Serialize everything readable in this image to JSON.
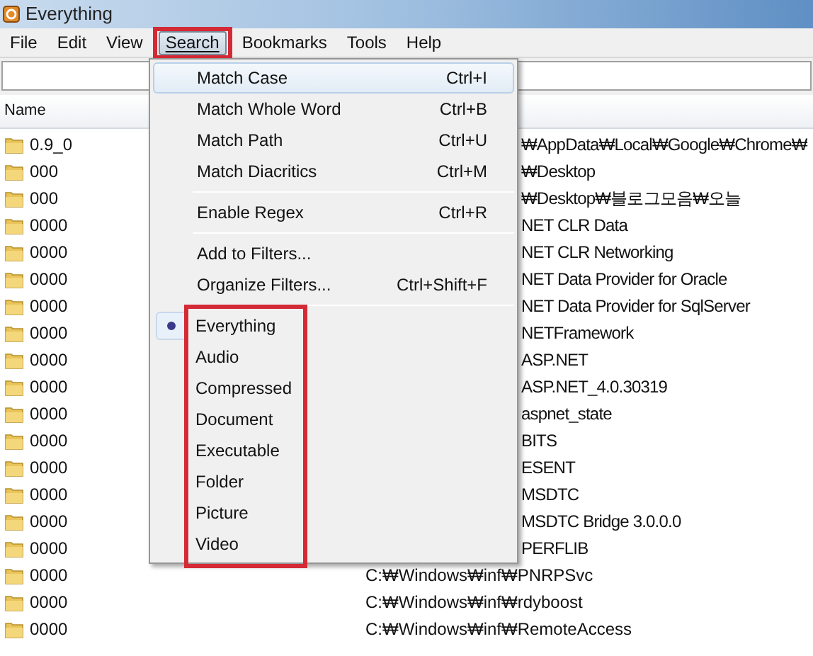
{
  "window": {
    "title": "Everything"
  },
  "menu_bar": [
    {
      "label": "File",
      "selected": false,
      "highlighted": false
    },
    {
      "label": "Edit",
      "selected": false,
      "highlighted": false
    },
    {
      "label": "View",
      "selected": false,
      "highlighted": false
    },
    {
      "label": "Search",
      "selected": true,
      "highlighted": true
    },
    {
      "label": "Bookmarks",
      "selected": false,
      "highlighted": false
    },
    {
      "label": "Tools",
      "selected": false,
      "highlighted": false
    },
    {
      "label": "Help",
      "selected": false,
      "highlighted": false
    }
  ],
  "table": {
    "columns": [
      "Name"
    ],
    "rows": [
      {
        "name": "0.9_0",
        "path": "₩AppData₩Local₩Google₩Chrome₩",
        "kind": "cut"
      },
      {
        "name": "000",
        "path": "₩Desktop",
        "kind": "cut"
      },
      {
        "name": "000",
        "path": "₩Desktop₩블로그모음₩오늘",
        "kind": "cut"
      },
      {
        "name": "0000",
        "path": "NET CLR Data",
        "kind": "cut"
      },
      {
        "name": "0000",
        "path": "NET CLR Networking",
        "kind": "cut"
      },
      {
        "name": "0000",
        "path": "NET Data Provider for Oracle",
        "kind": "cut"
      },
      {
        "name": "0000",
        "path": "NET Data Provider for SqlServer",
        "kind": "cut"
      },
      {
        "name": "0000",
        "path": "NETFramework",
        "kind": "cut"
      },
      {
        "name": "0000",
        "path": "ASP.NET",
        "kind": "cut"
      },
      {
        "name": "0000",
        "path": "ASP.NET_4.0.30319",
        "kind": "cut"
      },
      {
        "name": "0000",
        "path": "aspnet_state",
        "kind": "cut"
      },
      {
        "name": "0000",
        "path": "BITS",
        "kind": "cut"
      },
      {
        "name": "0000",
        "path": "ESENT",
        "kind": "cut"
      },
      {
        "name": "0000",
        "path": "MSDTC",
        "kind": "cut"
      },
      {
        "name": "0000",
        "path": "MSDTC Bridge 3.0.0.0",
        "kind": "cut"
      },
      {
        "name": "0000",
        "path": "PERFLIB",
        "kind": "cut"
      },
      {
        "name": "0000",
        "path": "C:₩Windows₩inf₩PNRPSvc",
        "kind": "full"
      },
      {
        "name": "0000",
        "path": "C:₩Windows₩inf₩rdyboost",
        "kind": "full"
      },
      {
        "name": "0000",
        "path": "C:₩Windows₩inf₩RemoteAccess",
        "kind": "full"
      }
    ]
  },
  "search_menu": {
    "items": [
      {
        "kind": "command",
        "label": "Match Case",
        "shortcut": "Ctrl+I",
        "hovered": true
      },
      {
        "kind": "command",
        "label": "Match Whole Word",
        "shortcut": "Ctrl+B",
        "hovered": false
      },
      {
        "kind": "command",
        "label": "Match Path",
        "shortcut": "Ctrl+U",
        "hovered": false
      },
      {
        "kind": "command",
        "label": "Match Diacritics",
        "shortcut": "Ctrl+M",
        "hovered": false
      },
      {
        "kind": "separator"
      },
      {
        "kind": "command",
        "label": "Enable Regex",
        "shortcut": "Ctrl+R",
        "hovered": false
      },
      {
        "kind": "separator"
      },
      {
        "kind": "command",
        "label": "Add to Filters...",
        "hovered": false
      },
      {
        "kind": "command",
        "label": "Organize Filters...",
        "shortcut": "Ctrl+Shift+F",
        "hovered": false
      },
      {
        "kind": "separator"
      }
    ],
    "filters_highlighted": true,
    "filters": [
      {
        "label": "Everything",
        "selected": true
      },
      {
        "label": "Audio",
        "selected": false
      },
      {
        "label": "Compressed",
        "selected": false
      },
      {
        "label": "Document",
        "selected": false
      },
      {
        "label": "Executable",
        "selected": false
      },
      {
        "label": "Folder",
        "selected": false
      },
      {
        "label": "Picture",
        "selected": false
      },
      {
        "label": "Video",
        "selected": false
      }
    ]
  }
}
